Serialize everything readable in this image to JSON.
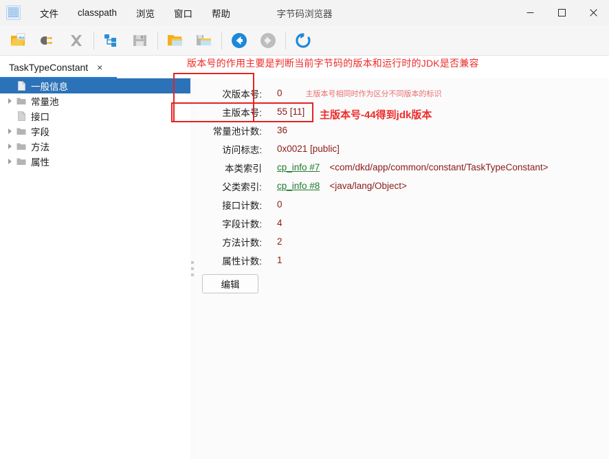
{
  "window": {
    "title": "字节码浏览器",
    "app_icon": "barcode-icon",
    "controls": {
      "minimize": "minimize-icon",
      "maximize": "maximize-icon",
      "close": "close-icon"
    }
  },
  "menubar": {
    "items": [
      {
        "label": "文件"
      },
      {
        "label": "classpath"
      },
      {
        "label": "浏览"
      },
      {
        "label": "窗口"
      },
      {
        "label": "帮助"
      }
    ]
  },
  "toolbar": {
    "buttons": [
      {
        "name": "open-file-icon",
        "enabled": true
      },
      {
        "name": "plug-connect-icon",
        "enabled": true
      },
      {
        "name": "close-x-icon",
        "enabled": false
      },
      {
        "name": "tree-structure-icon",
        "enabled": true
      },
      {
        "name": "save-icon",
        "enabled": false
      },
      {
        "name": "open-folder-window-icon",
        "enabled": true
      },
      {
        "name": "save-window-icon",
        "enabled": true
      },
      {
        "name": "back-arrow-icon",
        "enabled": true
      },
      {
        "name": "forward-arrow-icon",
        "enabled": false
      },
      {
        "name": "reload-icon",
        "enabled": true
      }
    ]
  },
  "tabs": {
    "items": [
      {
        "label": "TaskTypeConstant",
        "close": "×",
        "active": true
      }
    ]
  },
  "tree": {
    "items": [
      {
        "label": "一般信息",
        "icon": "page-icon",
        "expandable": false,
        "selected": true
      },
      {
        "label": "常量池",
        "icon": "folder-icon",
        "expandable": true,
        "selected": false
      },
      {
        "label": "接口",
        "icon": "page-icon",
        "expandable": false,
        "selected": false
      },
      {
        "label": "字段",
        "icon": "folder-icon",
        "expandable": true,
        "selected": false
      },
      {
        "label": "方法",
        "icon": "folder-icon",
        "expandable": true,
        "selected": false
      },
      {
        "label": "属性",
        "icon": "folder-icon",
        "expandable": true,
        "selected": false
      }
    ]
  },
  "detail": {
    "rows": [
      {
        "label": "次版本号:",
        "value": "0",
        "note": "主版本号相同时作为区分不同版本的标识"
      },
      {
        "label": "主版本号:",
        "value": "55 [11]",
        "note": ""
      },
      {
        "label": "常量池计数:",
        "value": "36",
        "note": ""
      },
      {
        "label": "访问标志:",
        "value": "0x0021 [public]",
        "note": ""
      }
    ],
    "index_rows": [
      {
        "label": "本类索引",
        "link": "cp_info #7",
        "desc": "<com/dkd/app/common/constant/TaskTypeConstant>"
      },
      {
        "label": "父类索引:",
        "link": "cp_info #8",
        "desc": "<java/lang/Object>"
      }
    ],
    "count_rows": [
      {
        "label": "接口计数:",
        "value": "0"
      },
      {
        "label": "字段计数:",
        "value": "4"
      },
      {
        "label": "方法计数:",
        "value": "2"
      },
      {
        "label": "属性计数:",
        "value": "1"
      }
    ],
    "edit_button": "编辑"
  },
  "annotations": {
    "title_note": "版本号的作用主要是判断当前字节码的版本和运行时的JDK是否兼容",
    "major_note": "主版本号-44得到jdk版本"
  },
  "colors": {
    "accent_blue": "#2c72b8",
    "annotation_red": "#ee2b2b",
    "value_red": "#8b1a1a",
    "link_green": "#1f7a2e",
    "tab_underline": "#2d7dd2"
  }
}
